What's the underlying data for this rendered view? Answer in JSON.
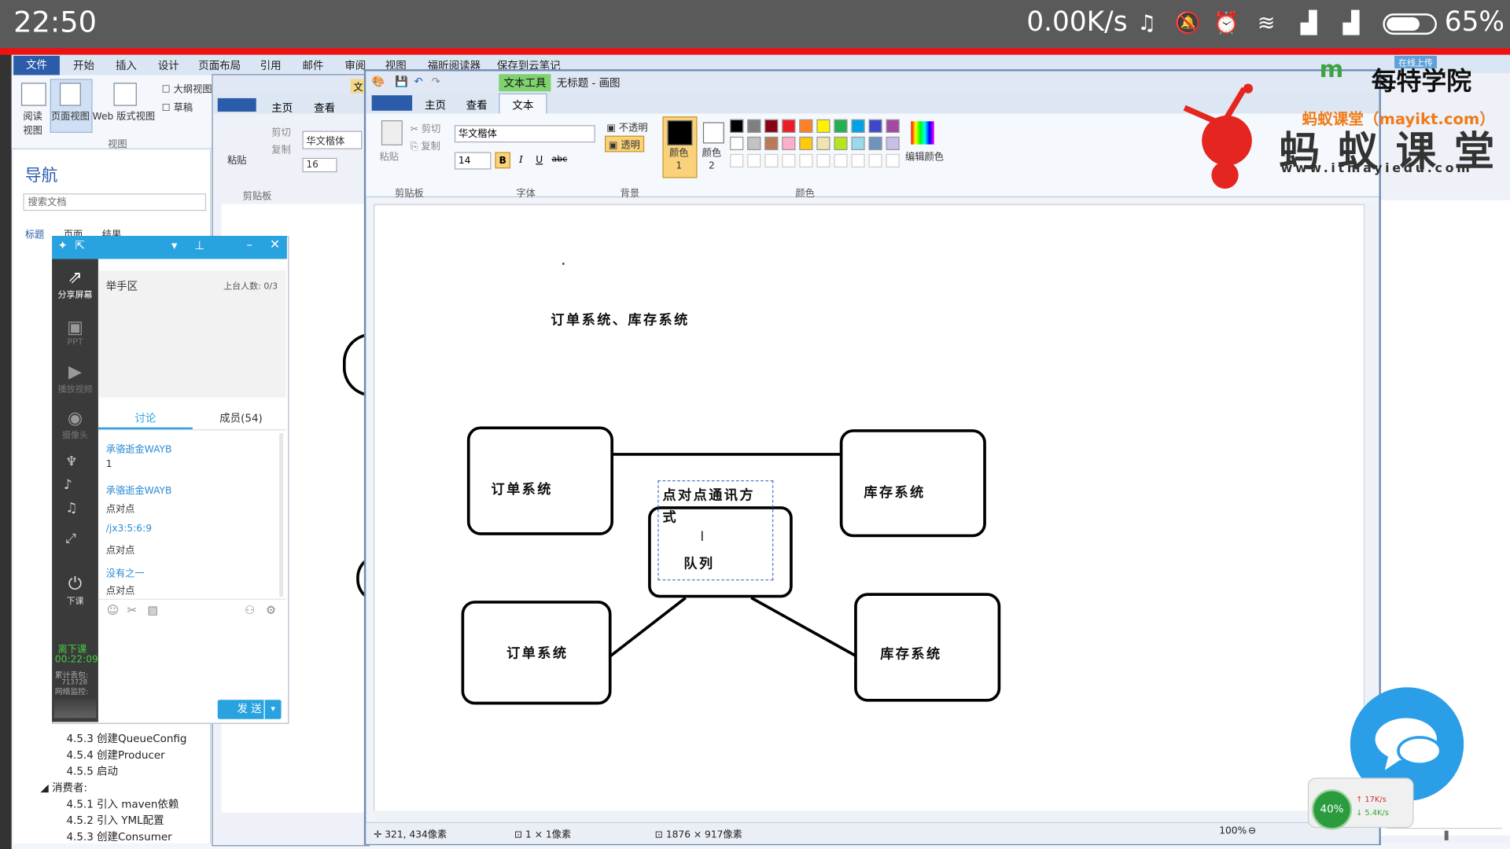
{
  "status_bar": {
    "time": "22:50",
    "net_speed": "0.00K/s",
    "battery": "65%"
  },
  "word": {
    "file_tab": "文件",
    "tabs": [
      "开始",
      "插入",
      "设计",
      "页面布局",
      "引用",
      "邮件",
      "审阅",
      "视图",
      "福昕阅读器",
      "保存到云笔记"
    ],
    "view_buttons": [
      "阅读视图",
      "页面视图",
      "Web 版式视图"
    ],
    "view_checks": [
      "大纲视图",
      "草稿"
    ],
    "view_group": "视图",
    "nav_title": "导航",
    "search_placeholder": "搜索文档",
    "nav_tabs": [
      "标题",
      "页面",
      "结果"
    ],
    "nav_items": [
      "4.5.3 创建QueueConfig",
      "4.5.4 创建Producer",
      "4.5.5 启动",
      "消费者:",
      "4.5.1 引入 maven依赖",
      "4.5.2 引入 YML配置",
      "4.5.3 创建Consumer"
    ]
  },
  "paint_bg": {
    "tabs": [
      "主页",
      "查看"
    ],
    "clipboard": [
      "粘贴",
      "剪切",
      "复制"
    ],
    "clipboard_group": "剪贴板",
    "font": "华文楷体",
    "size": "16",
    "text_tab": "文"
  },
  "chat": {
    "side": [
      "分享屏幕",
      "PPT",
      "播放视频",
      "摄像头",
      "下课"
    ],
    "hand_zone": "举手区",
    "stage_count": "上台人数: 0/3",
    "tabs": [
      "讨论",
      "成员(54)"
    ],
    "messages": [
      {
        "name": "承骆逝金WAYB",
        "text": "1"
      },
      {
        "name": "承骆逝金WAYB",
        "text": "点对点"
      },
      {
        "name": "/jx3:5:6:9",
        "text": "点对点"
      },
      {
        "name": "没有之一",
        "text": "点对点"
      }
    ],
    "timer_label": "离下课",
    "timer": "00:22:09",
    "stats": [
      "累计丢包:",
      "713728",
      "网络监控:"
    ],
    "send": "发 送"
  },
  "paint": {
    "title_tool": "文本工具",
    "title": "无标题 - 画图",
    "tabs": [
      "主页",
      "查看",
      "文本"
    ],
    "clipboard": [
      "粘贴",
      "剪切",
      "复制"
    ],
    "clipboard_group": "剪贴板",
    "font_name": "华文楷体",
    "font_size": "14",
    "font_group": "字体",
    "bg_options": [
      "不透明",
      "透明"
    ],
    "bg_group": "背景",
    "color1": "颜色 1",
    "color2": "颜色 2",
    "edit_colors": "编辑颜色",
    "colors_group": "颜色",
    "palette": [
      "#000000",
      "#7f7f7f",
      "#880015",
      "#ed1c24",
      "#ff7f27",
      "#fff200",
      "#22b14c",
      "#00a2e8",
      "#3f48cc",
      "#a349a4",
      "#ffffff",
      "#c3c3c3",
      "#b97a57",
      "#ffaec9",
      "#ffc90e",
      "#efe4b0",
      "#b5e61d",
      "#99d9ea",
      "#7092be",
      "#c8bfe7"
    ],
    "status": {
      "cursor": "321, 434像素",
      "selection": "1 × 1像素",
      "canvas": "1876 × 917像素",
      "zoom": "100%"
    }
  },
  "diagram": {
    "heading": "订单系统、库存系统",
    "box_tl": "订单系统",
    "box_tr": "库存系统",
    "box_bl": "订单系统",
    "box_br": "库存系统",
    "mid_text_1": "点对点通讯方",
    "mid_text_2": "式",
    "mid_text_3": "队列"
  },
  "overlay": {
    "logo_top": "每特学院",
    "logo_sub": "蚂蚁课堂（mayikt.com）",
    "logo_main": "蚂 蚁 课 堂",
    "logo_url": "www.itmayiedu.com",
    "upload": "在线上传",
    "net_badge": "40%",
    "net_up": "17K/s",
    "net_down": "5.4K/s"
  }
}
